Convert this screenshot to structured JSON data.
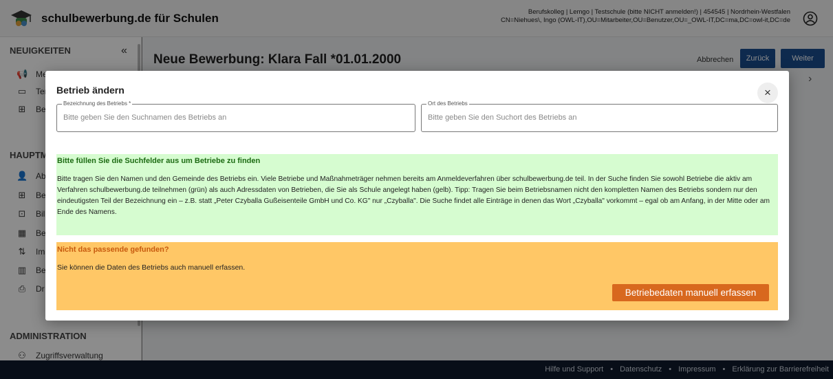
{
  "header": {
    "app_title": "schulbewerbung.de für Schulen",
    "user_info_line1": "Berufskolleg | Lemgo | Testschule (bitte NICHT anmelden!) | 454545 | Nordrhein-Westfalen",
    "user_info_line2": "CN=Niehues\\, Ingo (OWL-IT),OU=Mitarbeiter,OU=Benutzer,OU=_OWL-IT,DC=ma,DC=owl-it,DC=de"
  },
  "sidebar": {
    "section_news": "NEUIGKEITEN",
    "collapse_icon": "«",
    "news_items": [
      {
        "label": "Me",
        "icon": "megaphone-icon"
      },
      {
        "label": "Ter",
        "icon": "calendar-icon"
      },
      {
        "label": "Be",
        "icon": "post-add-icon"
      }
    ],
    "section_main": "HAUPTM",
    "main_items": [
      {
        "label": "Ab",
        "icon": "person-icon"
      },
      {
        "label": "Be",
        "icon": "post-add-icon"
      },
      {
        "label": "Bil",
        "icon": "account-tree-icon"
      },
      {
        "label": "Bet",
        "icon": "business-icon"
      },
      {
        "label": "Im",
        "icon": "import-export-icon"
      },
      {
        "label": "Be",
        "icon": "chart-icon"
      },
      {
        "label": "Dr",
        "icon": "print-icon"
      }
    ],
    "section_admin": "ADMINISTRATION",
    "admin_items": [
      {
        "label": "Zugriffsverwaltung",
        "icon": "people-icon"
      }
    ]
  },
  "main": {
    "page_title": "Neue Bewerbung: Klara Fall *01.01.2000",
    "cancel_label": "Abbrechen",
    "back_label": "Zurück",
    "next_label": "Weiter"
  },
  "modal": {
    "title": "Betrieb ändern",
    "close_label": "×",
    "field_name_label": "Bezeichnung des Betriebs *",
    "field_name_placeholder": "Bitte geben Sie den Suchnamen des Betriebs an",
    "field_ort_label": "Ort des Betriebs",
    "field_ort_placeholder": "Bitte geben Sie den Suchort des Betriebs an",
    "green_title": "Bitte füllen Sie die Suchfelder aus um Betriebe zu finden",
    "green_text": "Bitte tragen Sie den Namen und den Gemeinde des Betriebs ein. Viele Betriebe und Maßnahmeträger nehmen bereits am Anmeldeverfahren über schulbewerbung.de teil. In der Suche finden Sie sowohl Betriebe die aktiv am Verfahren schulbewerbung.de teilnehmen (grün) als auch Adressdaten von Betrieben, die Sie als Schule angelegt haben (gelb). Tipp: Tragen Sie beim Betriebsnamen nicht den kompletten Namen des Betriebs sondern nur den eindeutigsten Teil der Bezeichnung ein – z.B. statt „Peter Czyballa Gußeisenteile GmbH und Co. KG\" nur „Czyballa\". Die Suche findet alle Einträge in denen das Wort „Czyballa\" vorkommt – egal ob am Anfang, in der Mitte oder am Ende des Namens.",
    "orange_title": "Nicht das passende gefunden?",
    "orange_text": "Sie können die Daten des Betriebs auch manuell erfassen.",
    "manual_button_label": "Betriebedaten manuell erfassen"
  },
  "footer": {
    "links": [
      "Hilfe und Support",
      "Datenschutz",
      "Impressum",
      "Erklärung zur Barrierefreiheit"
    ],
    "separator": "•"
  },
  "colors": {
    "primary_blue": "#1a4d8f",
    "green_bg": "#d6fcd0",
    "green_title": "#1c6b12",
    "orange_bg": "#ffc766",
    "orange_title": "#c75a0e",
    "orange_button": "#d8681e",
    "footer_bg": "#0f1b2d"
  }
}
